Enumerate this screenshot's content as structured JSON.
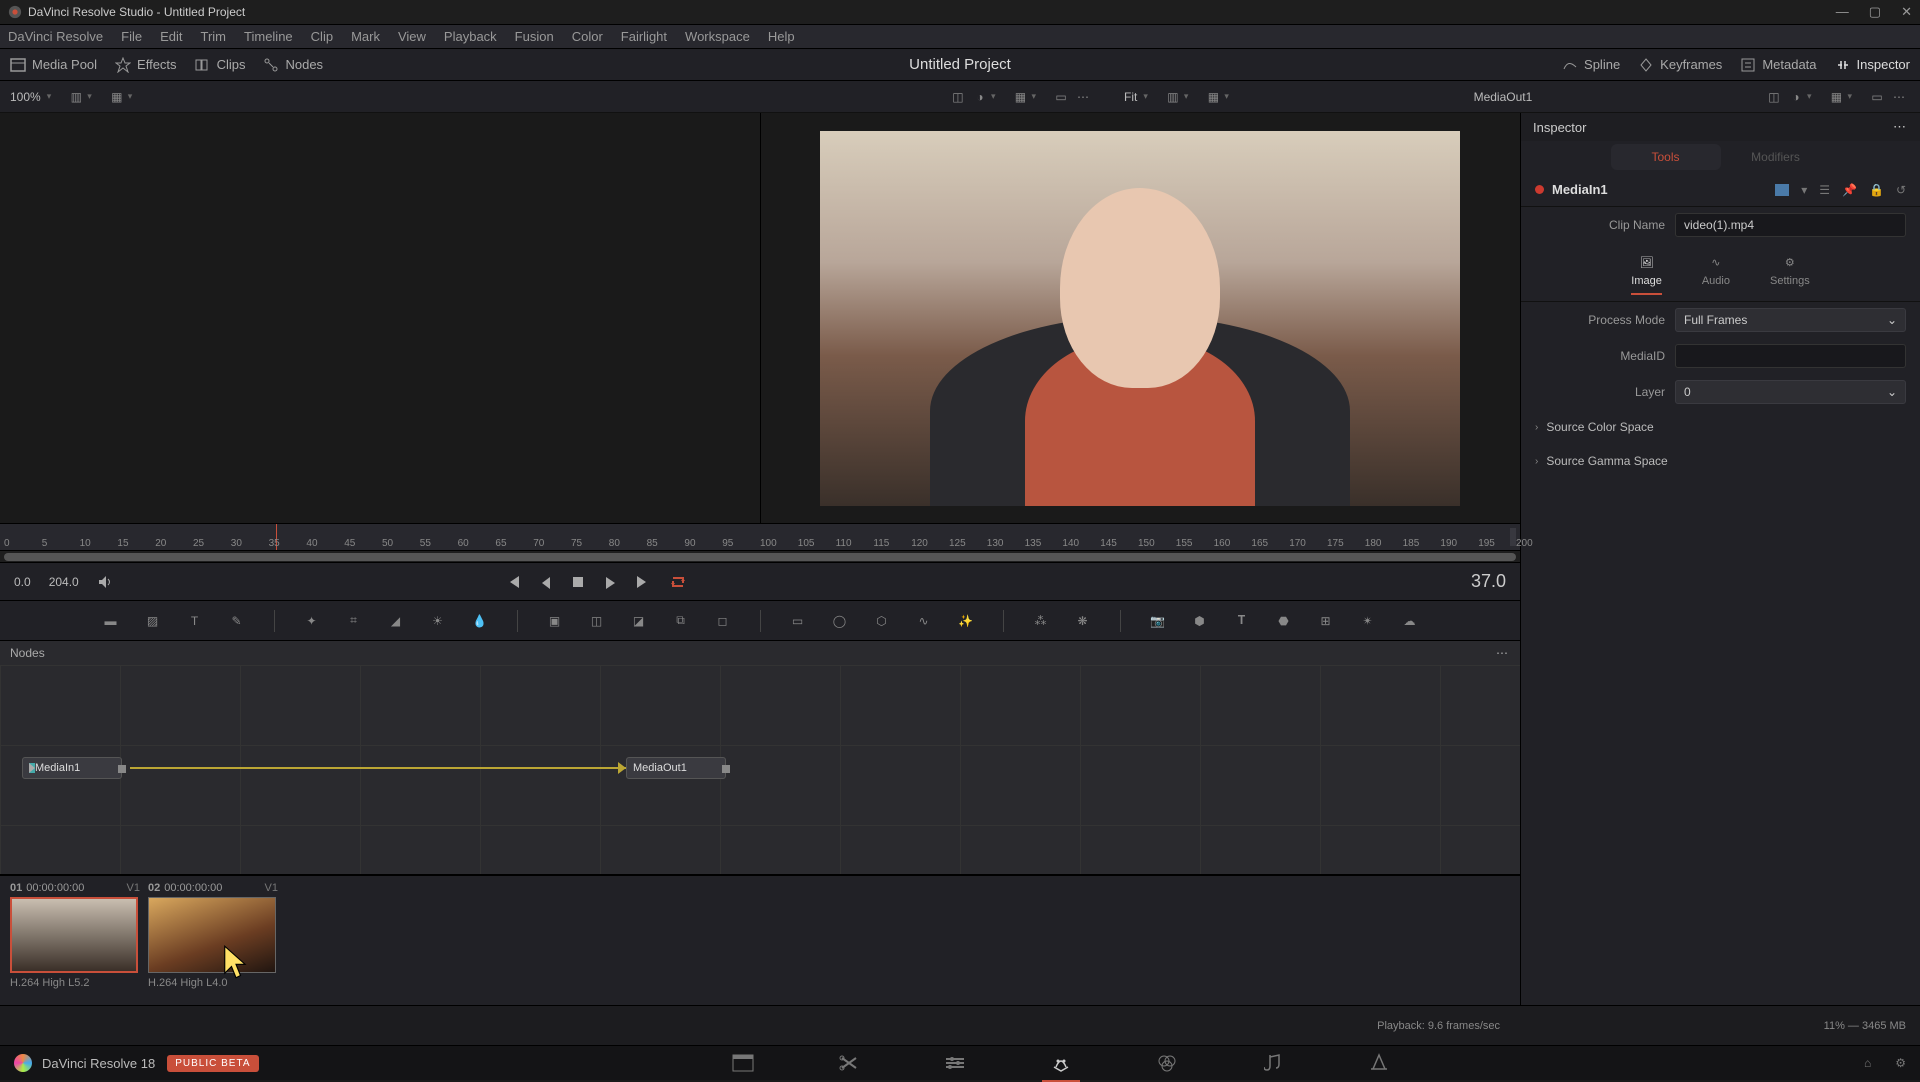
{
  "titlebar": {
    "text": "DaVinci Resolve Studio - Untitled Project"
  },
  "menu": [
    "DaVinci Resolve",
    "File",
    "Edit",
    "Trim",
    "Timeline",
    "Clip",
    "Mark",
    "View",
    "Playback",
    "Fusion",
    "Color",
    "Fairlight",
    "Workspace",
    "Help"
  ],
  "toolbar": {
    "left": [
      {
        "name": "media-pool",
        "label": "Media Pool"
      },
      {
        "name": "effects",
        "label": "Effects"
      },
      {
        "name": "clips",
        "label": "Clips"
      },
      {
        "name": "nodes",
        "label": "Nodes"
      }
    ],
    "project_title": "Untitled Project",
    "right": [
      {
        "name": "spline",
        "label": "Spline"
      },
      {
        "name": "keyframes",
        "label": "Keyframes"
      },
      {
        "name": "metadata",
        "label": "Metadata"
      },
      {
        "name": "inspector",
        "label": "Inspector"
      }
    ]
  },
  "viewer_bar": {
    "zoom": "100%",
    "fit": "Fit",
    "title": "MediaOut1"
  },
  "ruler": {
    "ticks": [
      "0",
      "5",
      "10",
      "15",
      "20",
      "25",
      "30",
      "35",
      "40",
      "45",
      "50",
      "55",
      "60",
      "65",
      "70",
      "75",
      "80",
      "85",
      "90",
      "95",
      "100",
      "105",
      "110",
      "115",
      "120",
      "125",
      "130",
      "135",
      "140",
      "145",
      "150",
      "155",
      "160",
      "165",
      "170",
      "175",
      "180",
      "185",
      "190",
      "195",
      "200"
    ],
    "playhead_pct": 18
  },
  "transport": {
    "in": "0.0",
    "out": "204.0",
    "current": "37.0"
  },
  "nodes_panel": {
    "title": "Nodes",
    "in_node": "MediaIn1",
    "out_node": "MediaOut1"
  },
  "clips": [
    {
      "idx": "01",
      "tc": "00:00:00:00",
      "track": "V1",
      "codec": "H.264 High L5.2",
      "selected": true
    },
    {
      "idx": "02",
      "tc": "00:00:00:00",
      "track": "V1",
      "codec": "H.264 High L4.0",
      "selected": false
    }
  ],
  "inspector": {
    "header": "Inspector",
    "tabs": {
      "active": "Tools",
      "inactive": "Modifiers"
    },
    "node_name": "MediaIn1",
    "clip_name_label": "Clip Name",
    "clip_name_value": "video(1).mp4",
    "sub_tabs": [
      "Image",
      "Audio",
      "Settings"
    ],
    "process_mode_label": "Process Mode",
    "process_mode_value": "Full Frames",
    "mediaid_label": "MediaID",
    "layer_label": "Layer",
    "layer_value": "0",
    "collapse1": "Source Color Space",
    "collapse2": "Source Gamma Space"
  },
  "status": {
    "playback": "Playback: 9.6 frames/sec",
    "mem": "11% — 3465 MB"
  },
  "page_nav": {
    "brand": "DaVinci Resolve 18",
    "badge": "PUBLIC BETA"
  }
}
